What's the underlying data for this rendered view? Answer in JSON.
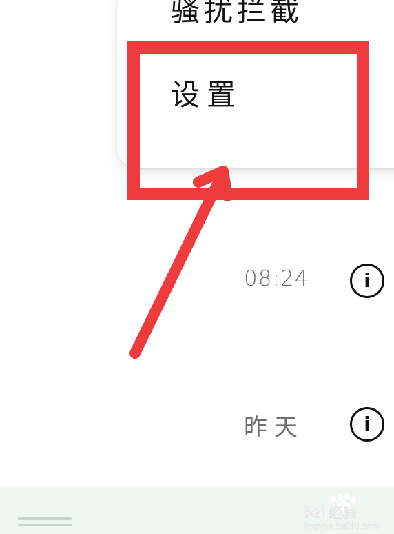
{
  "popup_menu": {
    "items": [
      {
        "label": "骚扰拦截"
      },
      {
        "label": "设置"
      }
    ]
  },
  "list": {
    "rows": [
      {
        "time": "08:24",
        "info_icon": "info-icon"
      },
      {
        "time": "昨天",
        "info_icon": "info-icon"
      }
    ]
  },
  "info_glyph": "i",
  "colors": {
    "annotation_red": "#ee3b3b",
    "bottom_bar_bg": "#eef7f2",
    "time_text": "#6f6f6f"
  },
  "watermark": {
    "brand": "Bai 经验",
    "url": "jingyan.baidu.com"
  }
}
